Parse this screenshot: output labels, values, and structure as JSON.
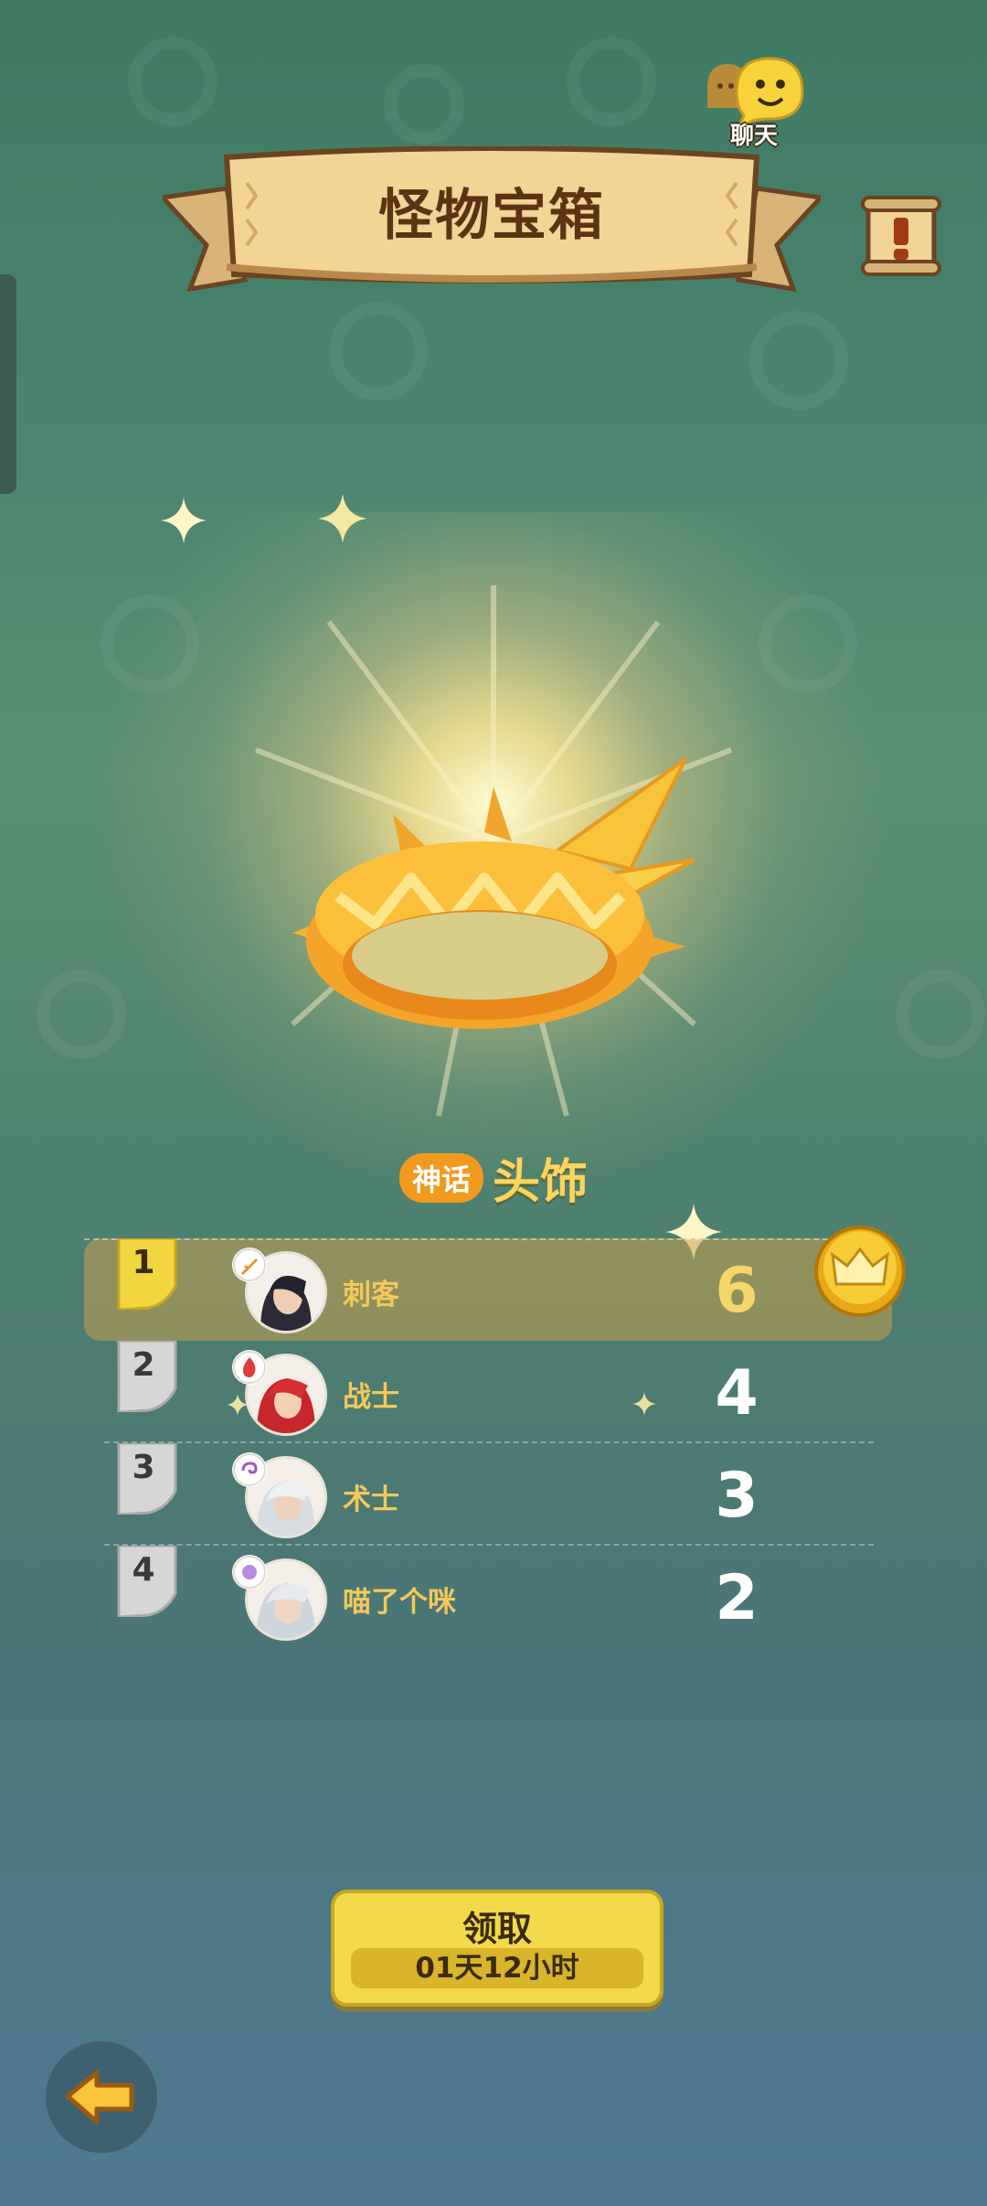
{
  "header": {
    "title": "怪物宝箱",
    "chat_label": "聊天"
  },
  "item": {
    "rarity": "神话",
    "name": "头饰"
  },
  "ranking": [
    {
      "rank": "1",
      "name": "刺客",
      "score": "6",
      "class_icon": "dagger-icon",
      "crown": true
    },
    {
      "rank": "2",
      "name": "战士",
      "score": "4",
      "class_icon": "fire-icon"
    },
    {
      "rank": "3",
      "name": "术士",
      "score": "3",
      "class_icon": "swirl-icon"
    },
    {
      "rank": "4",
      "name": "喵了个咪",
      "score": "2",
      "class_icon": "orb-icon"
    }
  ],
  "claim": {
    "label": "领取",
    "timer": "01天12小时"
  },
  "colors": {
    "gold": "#f4c95a",
    "rank1_flag": "#f2d640",
    "flag_gray": "#d6d6d6",
    "rarity": "#f29a1e"
  },
  "icons": {
    "back": "back-arrow-icon",
    "info": "exclamation-scroll-icon",
    "chat": "chat-bubble-icon"
  }
}
